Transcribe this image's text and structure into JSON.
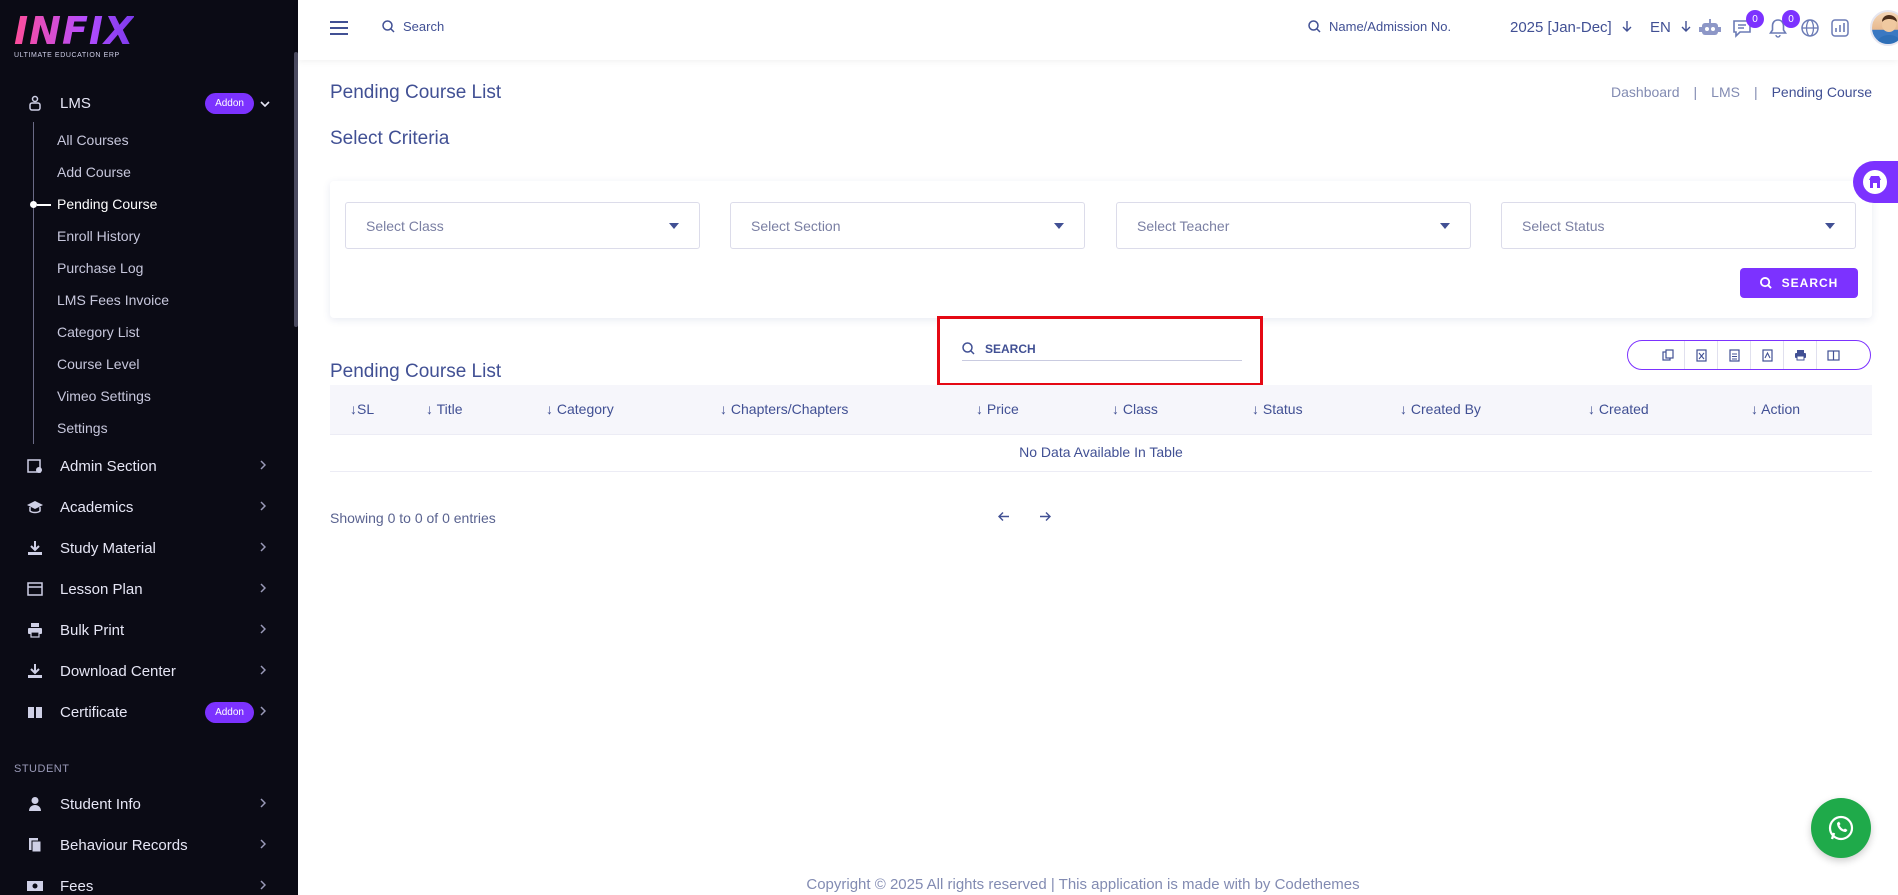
{
  "logo": {
    "main": "INFIX",
    "sub": "ULTIMATE EDUCATION ERP"
  },
  "sidebar": {
    "lms": {
      "label": "LMS",
      "badge": "Addon"
    },
    "sub_items": [
      "All Courses",
      "Add Course",
      "Pending Course",
      "Enroll History",
      "Purchase Log",
      "LMS Fees Invoice",
      "Category List",
      "Course Level",
      "Vimeo Settings",
      "Settings"
    ],
    "items": [
      {
        "label": "Admin Section"
      },
      {
        "label": "Academics"
      },
      {
        "label": "Study Material"
      },
      {
        "label": "Lesson Plan"
      },
      {
        "label": "Bulk Print"
      },
      {
        "label": "Download Center"
      },
      {
        "label": "Certificate",
        "badge": "Addon"
      }
    ],
    "section_student": "STUDENT",
    "student_items": [
      {
        "label": "Student Info"
      },
      {
        "label": "Behaviour Records"
      },
      {
        "label": "Fees"
      }
    ]
  },
  "topbar": {
    "search_label": "Search",
    "student_search_label": "Name/Admission No.",
    "year": "2025 [Jan-Dec]",
    "language": "EN",
    "chat_count": "0",
    "notification_count": "0"
  },
  "page": {
    "title": "Pending Course List",
    "breadcrumb": [
      "Dashboard",
      "LMS",
      "Pending Course"
    ],
    "criteria_title": "Select Criteria",
    "selects": [
      "Select Class",
      "Select Section",
      "Select Teacher",
      "Select Status"
    ],
    "search_button": "SEARCH",
    "table_search_placeholder": "SEARCH",
    "list_title": "Pending Course List",
    "columns": [
      "SL",
      "Title",
      "Category",
      "Chapters/Chapters",
      "Price",
      "Class",
      "Status",
      "Created By",
      "Created",
      "Action"
    ],
    "empty_message": "No Data Available In Table",
    "showing": "Showing 0 to 0 of 0 entries"
  },
  "footer": "Copyright © 2025 All rights reserved | This application is made with by Codethemes",
  "colors": {
    "accent": "#7c32ff",
    "text": "#415094",
    "sidebar_bg": "#0b0b15",
    "highlight": "#e50914",
    "whatsapp": "#1faa4a"
  }
}
